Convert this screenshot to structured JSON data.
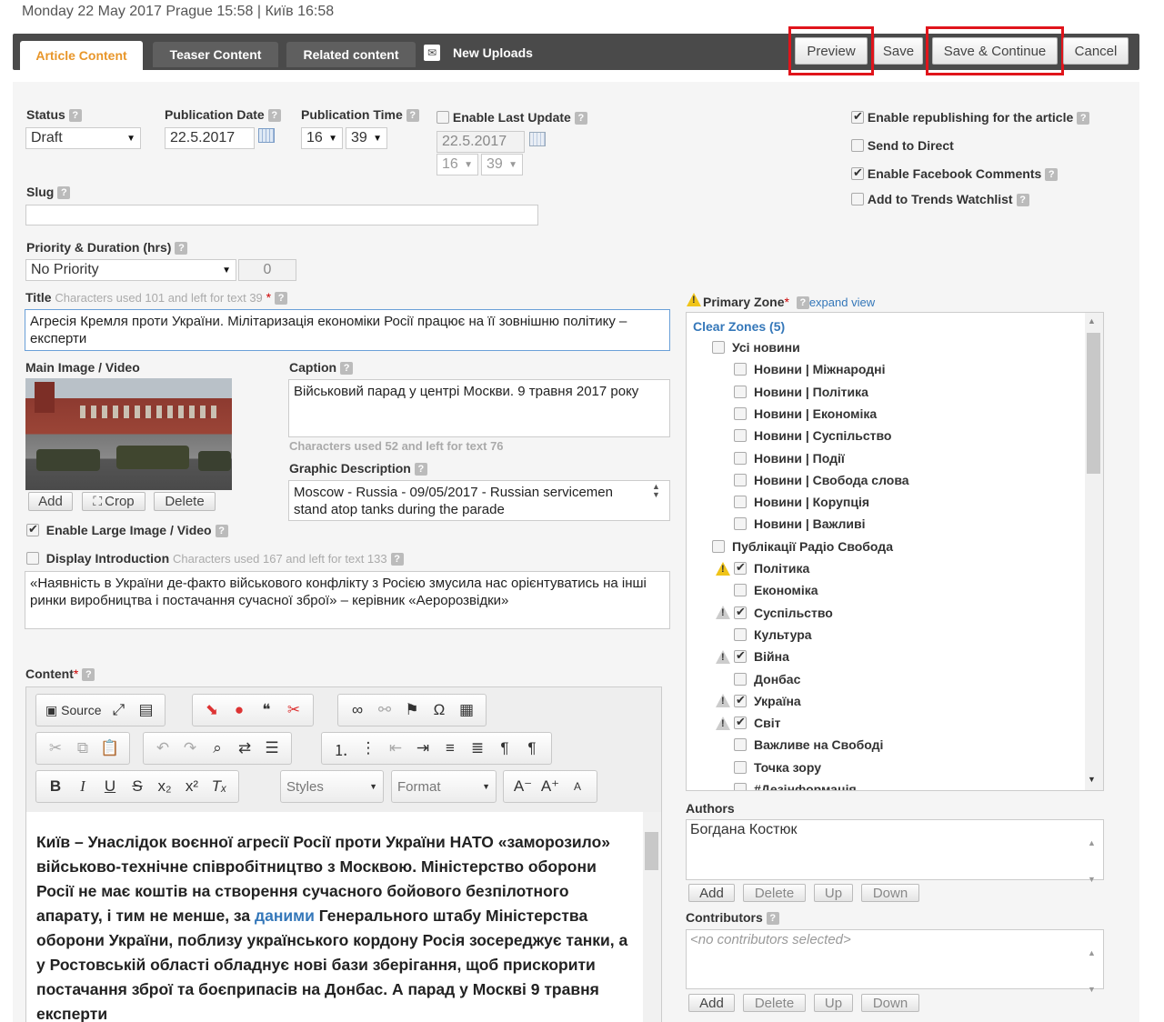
{
  "header_datetime": "Monday 22 May 2017 Prague 15:58 | Київ 16:58",
  "tabs": [
    "Article Content",
    "Teaser Content",
    "Related content",
    "New Uploads"
  ],
  "actions": {
    "preview": "Preview",
    "save": "Save",
    "save_continue": "Save & Continue",
    "cancel": "Cancel"
  },
  "status": {
    "label": "Status",
    "value": "Draft"
  },
  "publication_date": {
    "label": "Publication Date",
    "value": "22.5.2017"
  },
  "publication_time": {
    "label": "Publication Time",
    "hour": "16",
    "minute": "39"
  },
  "last_update": {
    "label": "Enable Last Update",
    "date": "22.5.2017",
    "hour": "16",
    "minute": "39"
  },
  "options": {
    "republish": "Enable republishing for the article",
    "send_direct": "Send to Direct",
    "facebook": "Enable Facebook Comments",
    "trends": "Add to Trends Watchlist"
  },
  "slug": {
    "label": "Slug",
    "value": ""
  },
  "priority": {
    "label": "Priority & Duration (hrs)",
    "value": "No Priority",
    "duration": "0"
  },
  "title": {
    "label": "Title",
    "hint": "Characters used 101 and left for text 39",
    "star": "*",
    "value": "Агресія Кремля проти України. Мілітаризація економіки Росії працює на її зовнішню політику – експерти"
  },
  "main_image": {
    "label": "Main Image / Video",
    "add": "Add",
    "crop": "Crop",
    "delete": "Delete",
    "enable_large": "Enable Large Image / Video"
  },
  "caption": {
    "label": "Caption",
    "value": "Військовий парад у центрі Москви. 9 травня 2017 року",
    "hint": "Characters used 52 and left for text 76"
  },
  "graphic_description": {
    "label": "Graphic Description",
    "value": "Moscow - Russia - 09/05/2017 - Russian servicemen stand atop tanks during the parade"
  },
  "introduction": {
    "label": "Display Introduction",
    "hint": "Characters used 167 and left for text 133",
    "value": "«Наявність в України де-факто військового конфлікту з Росією змусила нас орієнтуватись на інші ринки виробництва і постачання сучасної зброї» – керівник «Аеророзвідки»"
  },
  "content": {
    "label": "Content",
    "star": "*",
    "toolbar": {
      "source": "Source",
      "styles": "Styles",
      "format": "Format"
    },
    "text_before_link": "Київ – Унаслідок воєнної агресії Росії проти України НАТО «заморозило» військово-технічне співробітництво з Москвою. Міністерство оборони Росії не має коштів на створення сучасного бойового безпілотного апарату, і тим не менше, за ",
    "link_text": "даними",
    "text_after_link": " Генерального штабу Міністерства оборони України, поблизу українського кордону Росія зосереджує танки, а у Ростовській області обладнує нові бази зберігання, щоб прискорити постачання зброї та боєприпасів на Донбас. А парад у Москві 9 травня експерти"
  },
  "primary_zone": {
    "label": "Primary Zone",
    "star": "*",
    "expand": "expand view",
    "clear": "Clear Zones (5)"
  },
  "zones": [
    {
      "label": "Усі новини",
      "level": 0,
      "checked": false,
      "warn": ""
    },
    {
      "label": "Новини | Міжнародні",
      "level": 1,
      "checked": false,
      "warn": ""
    },
    {
      "label": "Новини | Політика",
      "level": 1,
      "checked": false,
      "warn": ""
    },
    {
      "label": "Новини | Економіка",
      "level": 1,
      "checked": false,
      "warn": ""
    },
    {
      "label": "Новини | Суспільство",
      "level": 1,
      "checked": false,
      "warn": ""
    },
    {
      "label": "Новини | Події",
      "level": 1,
      "checked": false,
      "warn": ""
    },
    {
      "label": "Новини | Свобода слова",
      "level": 1,
      "checked": false,
      "warn": ""
    },
    {
      "label": "Новини | Корупція",
      "level": 1,
      "checked": false,
      "warn": ""
    },
    {
      "label": "Новини | Важливі",
      "level": 1,
      "checked": false,
      "warn": ""
    },
    {
      "label": "Публікації Радіо Свобода",
      "level": 0,
      "checked": false,
      "warn": ""
    },
    {
      "label": "Політика",
      "level": 1,
      "checked": true,
      "warn": "yellow"
    },
    {
      "label": "Економіка",
      "level": 1,
      "checked": false,
      "warn": ""
    },
    {
      "label": "Суспільство",
      "level": 1,
      "checked": true,
      "warn": "grey"
    },
    {
      "label": "Культура",
      "level": 1,
      "checked": false,
      "warn": ""
    },
    {
      "label": "Війна",
      "level": 1,
      "checked": true,
      "warn": "grey"
    },
    {
      "label": "Донбас",
      "level": 1,
      "checked": false,
      "warn": ""
    },
    {
      "label": "Україна",
      "level": 1,
      "checked": true,
      "warn": "grey"
    },
    {
      "label": "Світ",
      "level": 1,
      "checked": true,
      "warn": "grey"
    },
    {
      "label": "Важливе на Свободі",
      "level": 1,
      "checked": false,
      "warn": ""
    },
    {
      "label": "Точка зору",
      "level": 1,
      "checked": false,
      "warn": ""
    },
    {
      "label": "#Дезінформація",
      "level": 1,
      "checked": false,
      "warn": ""
    }
  ],
  "authors": {
    "label": "Authors",
    "value": "Богдана Костюк",
    "add": "Add",
    "delete": "Delete",
    "up": "Up",
    "down": "Down"
  },
  "contributors": {
    "label": "Contributors",
    "placeholder": "<no contributors selected>",
    "add": "Add",
    "delete": "Delete",
    "up": "Up",
    "down": "Down"
  }
}
